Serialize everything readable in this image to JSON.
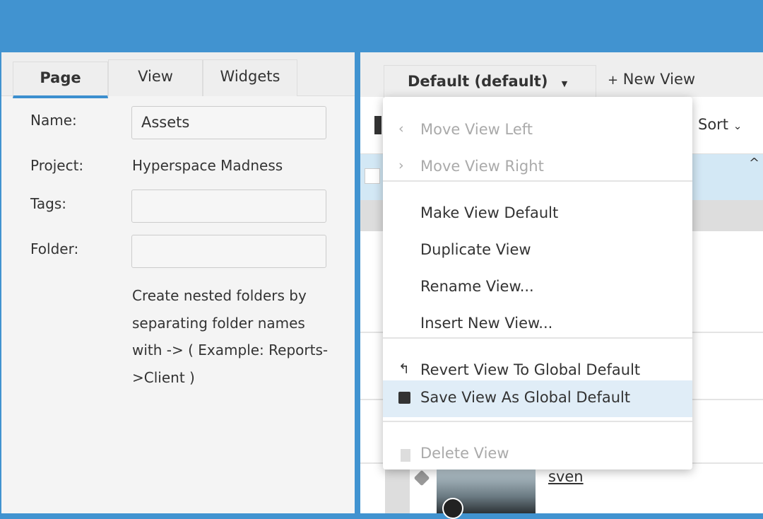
{
  "left_panel": {
    "tabs": [
      {
        "label": "Page",
        "active": true
      },
      {
        "label": "View",
        "active": false
      },
      {
        "label": "Widgets",
        "active": false
      }
    ],
    "fields": {
      "name_label": "Name:",
      "name_value": "Assets",
      "project_label": "Project:",
      "project_value": "Hyperspace Madness",
      "tags_label": "Tags:",
      "tags_value": "",
      "folder_label": "Folder:",
      "folder_value": "",
      "folder_help": "Create nested folders by separating folder names with -> ( Example: Reports->Client )"
    }
  },
  "right_panel": {
    "view_selector": "Default (default)",
    "new_view": "New View",
    "sort": "Sort",
    "row_link": "sven"
  },
  "menu": {
    "items": [
      {
        "label": "Move View Left",
        "icon": "chevron-left-icon",
        "disabled": true
      },
      {
        "label": "Move View Right",
        "icon": "chevron-right-icon",
        "disabled": true
      },
      {
        "label": "Make View Default"
      },
      {
        "label": "Duplicate View"
      },
      {
        "label": "Rename View..."
      },
      {
        "label": "Insert New View..."
      },
      {
        "label": "Revert View To Global Default",
        "icon": "undo-icon"
      },
      {
        "label": "Save View As Global Default",
        "icon": "floppy-disk-icon",
        "highlighted": true
      },
      {
        "label": "Delete View",
        "icon": "trash-icon",
        "disabled": true
      }
    ]
  },
  "colors": {
    "accent": "#4193d0",
    "highlight": "#e0edf7",
    "selected_row": "#d3e8f5"
  }
}
